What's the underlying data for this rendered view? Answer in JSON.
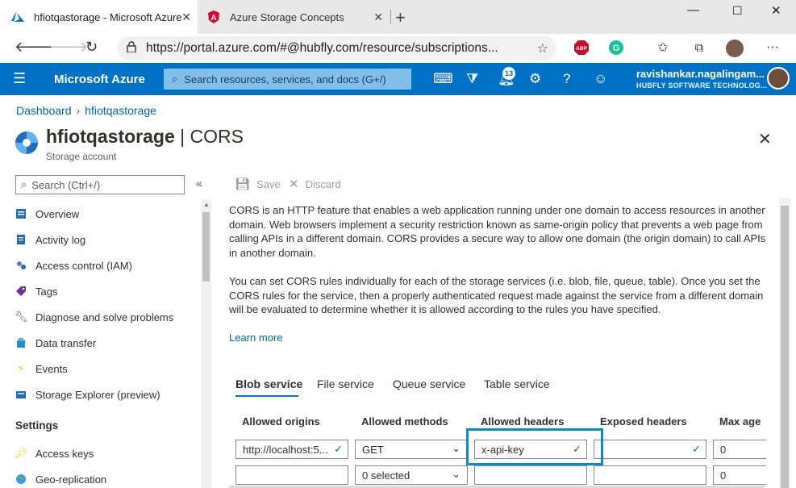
{
  "browser": {
    "tabs": [
      {
        "title": "hfiotqastorage - Microsoft Azure",
        "active": true
      },
      {
        "title": "Azure Storage Concepts",
        "active": false
      }
    ],
    "url": "https://portal.azure.com/#@hubfly.com/resource/subscriptions...",
    "extension_abp": "ABP",
    "extension_g": "G"
  },
  "azure": {
    "brand": "Microsoft Azure",
    "search_placeholder": "Search resources, services, and docs (G+/)",
    "notification_count": "13",
    "user_name": "ravishankar.nagalingam...",
    "user_org": "HUBFLY SOFTWARE TECHNOLOG..."
  },
  "breadcrumb": {
    "items": [
      "Dashboard",
      "hfiotqastorage"
    ]
  },
  "resource": {
    "name": "hfiotqastorage",
    "blade": "CORS",
    "separator": "|",
    "type": "Storage account"
  },
  "menu": {
    "search_placeholder": "Search (Ctrl+/)",
    "items": [
      {
        "label": "Overview",
        "icon": "overview-icon"
      },
      {
        "label": "Activity log",
        "icon": "activity-log-icon"
      },
      {
        "label": "Access control (IAM)",
        "icon": "iam-icon"
      },
      {
        "label": "Tags",
        "icon": "tag-icon"
      },
      {
        "label": "Diagnose and solve problems",
        "icon": "wrench-icon"
      },
      {
        "label": "Data transfer",
        "icon": "data-transfer-icon"
      },
      {
        "label": "Events",
        "icon": "lightning-icon"
      },
      {
        "label": "Storage Explorer (preview)",
        "icon": "storage-explorer-icon"
      }
    ],
    "settings_header": "Settings",
    "settings_items": [
      {
        "label": "Access keys",
        "icon": "key-icon"
      },
      {
        "label": "Geo-replication",
        "icon": "globe-icon"
      }
    ]
  },
  "toolbar": {
    "save": "Save",
    "discard": "Discard"
  },
  "content": {
    "para1": "CORS is an HTTP feature that enables a web application running under one domain to access resources in another domain. Web browsers implement a security restriction known as same-origin policy that prevents a web page from calling APIs in a different domain. CORS provides a secure way to allow one domain (the origin domain) to call APIs in another domain.",
    "para2": "You can set CORS rules individually for each of the storage services (i.e. blob, file, queue, table). Once you set the CORS rules for the service, then a properly authenticated request made against the service from a different domain will be evaluated to determine whether it is allowed according to the rules you have specified.",
    "learn_more": "Learn more",
    "tabs": [
      "Blob service",
      "File service",
      "Queue service",
      "Table service"
    ],
    "columns": [
      "Allowed origins",
      "Allowed methods",
      "Allowed headers",
      "Exposed headers",
      "Max age"
    ],
    "rows": [
      {
        "origins": "http://localhost:5...",
        "methods": "GET",
        "headers": "x-api-key",
        "exposed": "",
        "max_age": "0"
      },
      {
        "origins": "",
        "methods": "0 selected",
        "headers": "",
        "exposed": "",
        "max_age": "0"
      }
    ]
  },
  "colors": {
    "azure_blue": "#0072c6",
    "link": "#0063b1",
    "highlight": "#0a8acf",
    "valid_check": "#107c10"
  }
}
